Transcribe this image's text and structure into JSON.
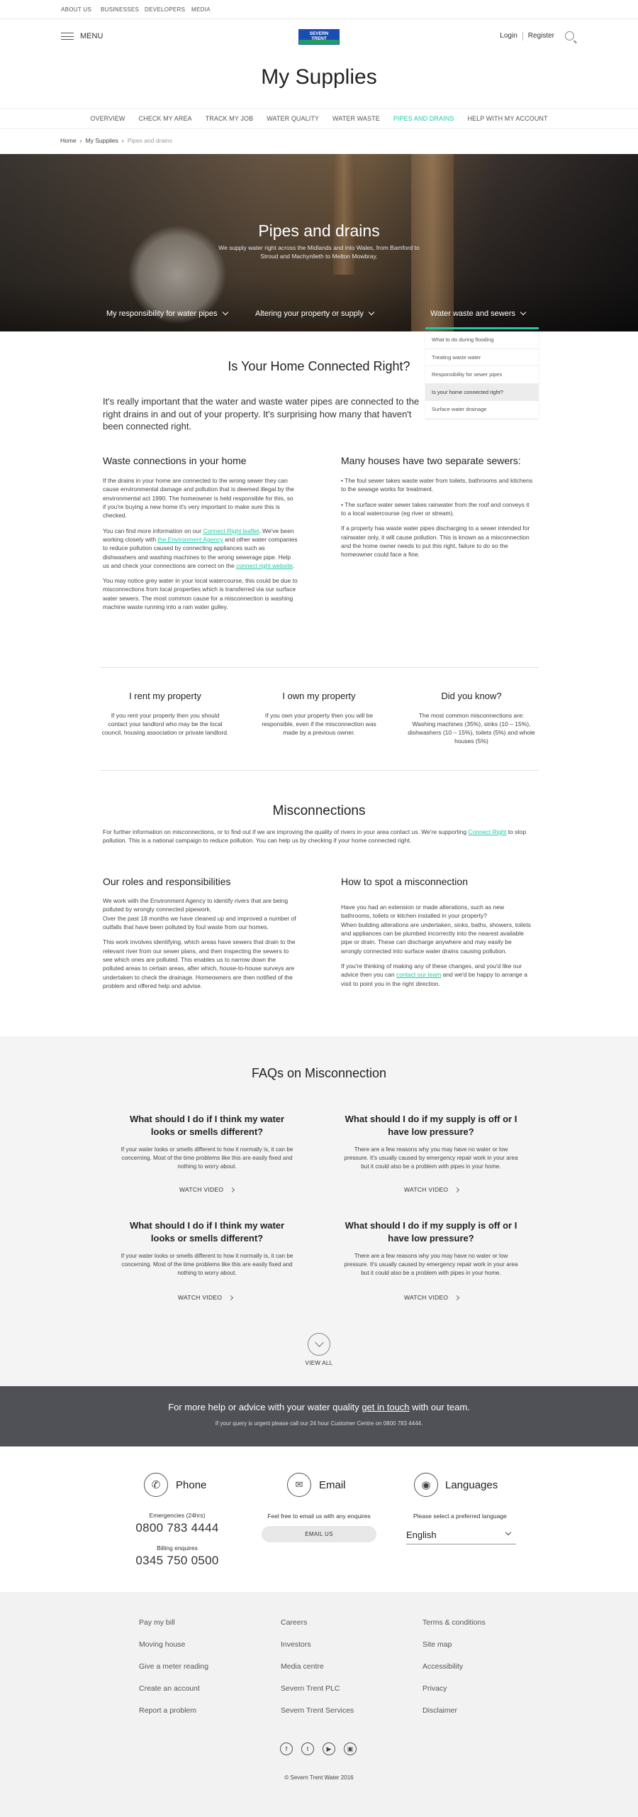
{
  "util_nav": [
    "ABOUT US",
    "BUSINESSES",
    "DEVELOPERS",
    "MEDIA"
  ],
  "header": {
    "menu_label": "MENU",
    "logo_line1": "SEVERN",
    "logo_line2": "TRENT",
    "login": "Login",
    "register": "Register",
    "page_title": "My Supplies"
  },
  "section_nav": [
    "OVERVIEW",
    "CHECK MY AREA",
    "TRACK MY JOB",
    "WATER QUALITY",
    "WATER WASTE",
    "PIPES AND DRAINS",
    "HELP WITH MY ACCOUNT"
  ],
  "breadcrumb": {
    "home": "Home",
    "parent": "My Supplies",
    "current": "Pipes and drains",
    "sep": "›"
  },
  "hero": {
    "title": "Pipes and drains",
    "subtitle": "We supply water right across the Midlands and into Wales, from Bamford to Stroud and Machynlleth to Melton Mowbray.",
    "tabs": [
      "My responsibility for water pipes",
      "Altering your property or supply",
      "Water waste and sewers"
    ]
  },
  "dropdown": [
    "What to do during flooding",
    "Treating waste water",
    "Responsibility for sewer pipes",
    "Is your home connected right?",
    "Surface water drainage"
  ],
  "main": {
    "title": "Is Your Home Connected Right?",
    "lead": "It's really important that the water and waste water pipes are connected to the right drains in and out of your property. It's surprising how many that haven't been connected right.",
    "left_h": "Waste connections in your home",
    "left_p1": "If the drains in your home are connected to the wrong sewer they can cause environmental damage and pollution that is deemed illegal by the environmental act 1990. The homeowner is held responsible for this, so if you're buying a new home it's very important to make sure this is checked.",
    "left_p2a": "You can find more information on our ",
    "left_p2_link1": "Connect Right leaflet",
    "left_p2b": ". We've been working closely with ",
    "left_p2_link2": "the Environment Agency",
    "left_p2c": " and other water companies to reduce pollution caused by connecting appliances such as dishwashers and washing machines to the wrong sewerage pipe. Help us and check your connections are correct on the ",
    "left_p2_link3": "connect right website",
    "left_p2d": ".",
    "left_p3": "You may notice grey water in your local watercourse, this could be due to misconnections from local properties which is transferred via our surface water sewers. The most common cause for a misconnection is washing machine waste running into a rain water gulley.",
    "right_h": "Many houses have two separate sewers:",
    "right_p1": "• The foul sewer takes waste water from toilets, bathrooms and kitchens to the sewage works for treatment.",
    "right_p2": "• The surface water sewer takes rainwater from the roof and conveys it to a local watercourse (eg river or stream).",
    "right_p3": "If a property has waste water pipes discharging to a sewer intended for rainwater only, it will cause pollution. This is known as a misconnection and the home owner needs to put this right, failure to do so the homeowner could face a fine."
  },
  "cards": [
    {
      "title": "I rent my property",
      "text": "If you rent your property then you should contact your landlord who may be the local council, housing association or private landlord."
    },
    {
      "title": "I own my property",
      "text": "If you own your property then you will be responsible, even if the misconnection was made by a previous owner."
    },
    {
      "title": "Did you know?",
      "text": "The most common misconnections are: Washing machines (35%), sinks (10 – 15%), dishwashers (10 – 15%), toilets (5%) and whole houses (5%)"
    }
  ],
  "misc": {
    "title": "Misconnections",
    "intro_a": "For further information on misconnections, or to find out if we are improving the quality of rivers in your area contact us. We're supporting ",
    "intro_link": "Connect Right",
    "intro_b": " to stop pollution. This is a national campaign to reduce pollution. You can help us by checking if your home connected right.",
    "roles_h": "Our roles and responsibilities",
    "roles_p1": "We work with the Environment Agency to identify rivers that are being polluted by wrongly connected pipework.",
    "roles_p2": "Over the past 18 months we have cleaned up and improved a number of outfalls that have been polluted by foul waste from our homes.",
    "roles_p3": "This work involves identifying, which areas have sewers that drain to the relevant river from our sewer plans, and then inspecting the sewers to see which ones are polluted. This enables us to narrow down the polluted areas to certain areas, after which, house-to-house surveys are undertaken to check the drainage. Homeowners are then notified of the problem and offered help and advise.",
    "spot_h": "How to spot a misconnection",
    "spot_p1": "Have you had an extension or made alterations, such as new bathrooms, toilets or kitchen installed in your property?",
    "spot_p2": "When building alterations are undertaken, sinks, baths, showers, toilets and appliances can be plumbed incorrectly into the nearest available pipe or drain. These can discharge anywhere and may easily be wrongly connected into surface water drains causing pollution.",
    "spot_p3a": "If you're thinking of making any of these changes, and you'd like our advice then you can ",
    "spot_link": "contact our team",
    "spot_p3b": " and we'd be happy to arrange a visit to point you in the right direction."
  },
  "faq": {
    "title": "FAQs on Misconnection",
    "items": [
      {
        "q": "What should I do if I think my water looks or smells different?",
        "a": "If your water looks or smells different to how it normally is, it can be concerning. Most of the time problems like this are easily fixed and nothing to worry about.",
        "cta": "WATCH VIDEO"
      },
      {
        "q": "What should I do if my supply is off or I have low pressure?",
        "a": "There are a few reasons why you may have no water or low pressure. It's usually caused by emergency repair work in your area but it could also be a problem with pipes in your home.",
        "cta": "WATCH VIDEO"
      },
      {
        "q": "What should I do if I think my water looks or smells different?",
        "a": "If your water looks or smells different to how it normally is, it can be concerning. Most of the time problems like this are easily fixed and nothing to worry about.",
        "cta": "WATCH VIDEO"
      },
      {
        "q": "What should I do if my supply is off or I have low pressure?",
        "a": "There are a few reasons why you may have no water or low pressure. It's usually caused by emergency repair work in your area but it could also be a problem with pipes in your home.",
        "cta": "WATCH VIDEO"
      }
    ],
    "view_all": "VIEW ALL"
  },
  "band": {
    "text_a": "For more help or advice with your water quality ",
    "link": "get in touch",
    "text_b": " with our team.",
    "sub": "If your query is urgent please call our 24 hour Customer Centre on 0800 783 4444."
  },
  "contact": {
    "phone_h": "Phone",
    "emerg_label": "Emergencies (24hrs)",
    "emerg_num": "0800 783 4444",
    "billing_label": "Billing enquires",
    "billing_num": "0345 750 0500",
    "email_h": "Email",
    "email_text": "Feel free to email us with any enquires",
    "email_btn": "EMAIL US",
    "lang_h": "Languages",
    "lang_text": "Please select a preferred language",
    "lang_value": "English"
  },
  "footer": {
    "col1": [
      "Pay my bill",
      "Moving house",
      "Give a meter reading",
      "Create an account",
      "Report a problem"
    ],
    "col2": [
      "Careers",
      "Investors",
      "Media centre",
      "Severn Trent PLC",
      "Severn Trent Services"
    ],
    "col3": [
      "Terms & conditions",
      "Site map",
      "Accessibility",
      "Privacy",
      "Disclaimer"
    ],
    "copyright": "© Severn Trent Water 2016"
  },
  "colors": {
    "accent": "#1fc9a6",
    "brand_blue": "#1a4db3",
    "brand_green": "#1fa05a",
    "band": "#505156"
  }
}
